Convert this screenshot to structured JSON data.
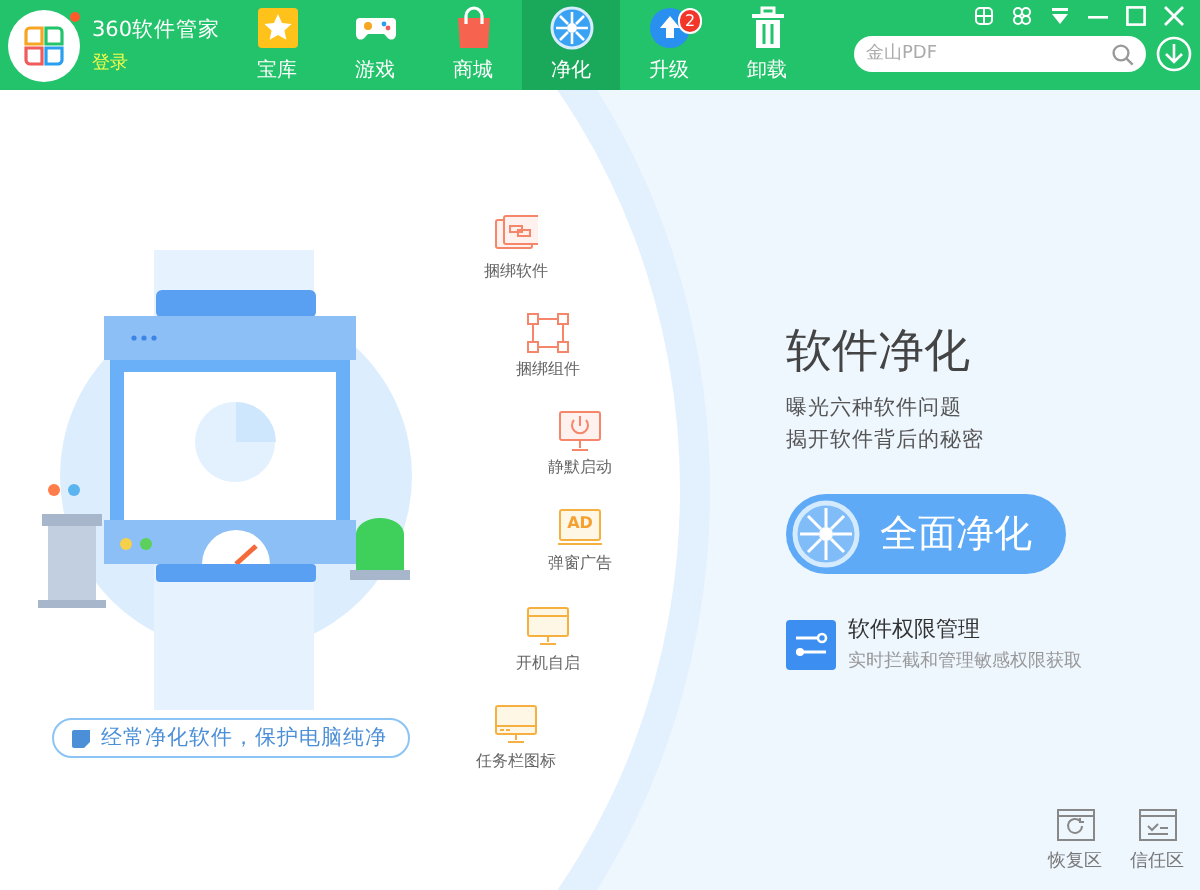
{
  "app": {
    "title": "360软件管家",
    "login": "登录",
    "notification": true
  },
  "nav_tabs": [
    {
      "label": "宝库",
      "kind": "star",
      "selected": false
    },
    {
      "label": "游戏",
      "kind": "gamepad",
      "selected": false
    },
    {
      "label": "商城",
      "kind": "bag",
      "selected": false
    },
    {
      "label": "净化",
      "kind": "fan",
      "selected": true
    },
    {
      "label": "升级",
      "kind": "upgrade",
      "selected": false,
      "badge": "2"
    },
    {
      "label": "卸载",
      "kind": "trash",
      "selected": false
    }
  ],
  "search": {
    "placeholder": "金山PDF"
  },
  "illustration": {
    "caption": "经常净化软件，保护电脑纯净"
  },
  "categories": [
    {
      "label": "捆绑软件",
      "kind": "windows"
    },
    {
      "label": "捆绑组件",
      "kind": "nodes"
    },
    {
      "label": "静默启动",
      "kind": "power"
    },
    {
      "label": "弹窗广告",
      "kind": "ad",
      "icon_text": "AD"
    },
    {
      "label": "开机自启",
      "kind": "monitor"
    },
    {
      "label": "任务栏图标",
      "kind": "taskbar"
    }
  ],
  "panel": {
    "title": "软件净化",
    "lines": [
      "曝光六种软件问题",
      "揭开软件背后的秘密"
    ],
    "button": "全面净化",
    "feature": {
      "title": "软件权限管理",
      "description": "实时拦截和管理敏感权限获取"
    }
  },
  "bottom_tools": [
    {
      "label": "恢复区",
      "kind": "restore"
    },
    {
      "label": "信任区",
      "kind": "trust"
    }
  ]
}
